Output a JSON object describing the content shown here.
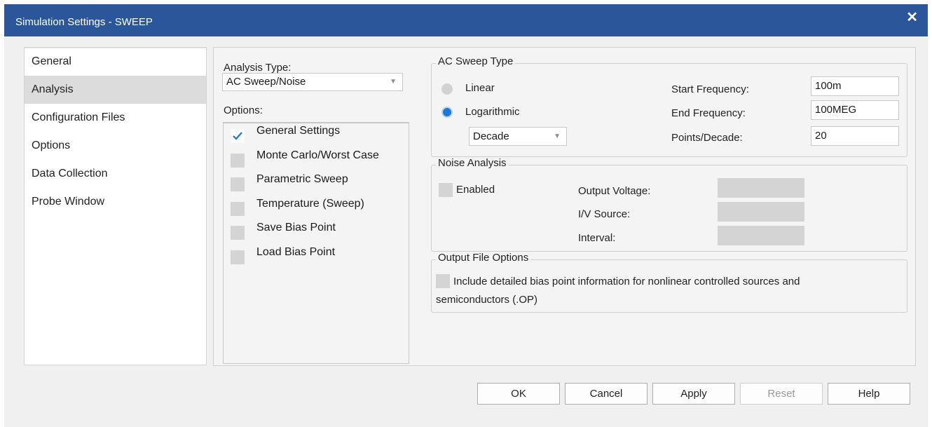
{
  "window": {
    "title": "Simulation Settings - SWEEP",
    "close_glyph": "✕"
  },
  "nav": {
    "items": [
      "General",
      "Analysis",
      "Configuration Files",
      "Options",
      "Data Collection",
      "Probe Window"
    ],
    "active": "Analysis"
  },
  "analysis_type": {
    "label": "Analysis Type:",
    "value": "AC Sweep/Noise"
  },
  "options": {
    "label": "Options:",
    "items": [
      {
        "label": "General Settings",
        "checked": true
      },
      {
        "label": "Monte Carlo/Worst Case",
        "checked": false
      },
      {
        "label": "Parametric Sweep",
        "checked": false
      },
      {
        "label": "Temperature (Sweep)",
        "checked": false
      },
      {
        "label": "Save Bias Point",
        "checked": false
      },
      {
        "label": "Load Bias Point",
        "checked": false
      }
    ]
  },
  "ac_sweep": {
    "title": "AC Sweep Type",
    "linear_label": "Linear",
    "log_label": "Logarithmic",
    "selected": "Logarithmic",
    "log_mode": "Decade",
    "start_label": "Start Frequency:",
    "start_value": "100m",
    "end_label": "End Frequency:",
    "end_value": "100MEG",
    "points_label": "Points/Decade:",
    "points_value": "20"
  },
  "noise": {
    "title": "Noise Analysis",
    "enabled_label": "Enabled",
    "output_voltage_label": "Output Voltage:",
    "iv_source_label": "I/V Source:",
    "interval_label": "Interval:"
  },
  "output_file": {
    "title": "Output File Options",
    "line1": "Include detailed bias point information for nonlinear controlled sources and",
    "line2": "semiconductors (.OP)"
  },
  "buttons": {
    "ok": "OK",
    "cancel": "Cancel",
    "apply": "Apply",
    "reset": "Reset",
    "help": "Help"
  },
  "colors": {
    "titlebar": "#2b579a",
    "radio_selected": "#1e78d4",
    "check": "#1e78d4"
  }
}
